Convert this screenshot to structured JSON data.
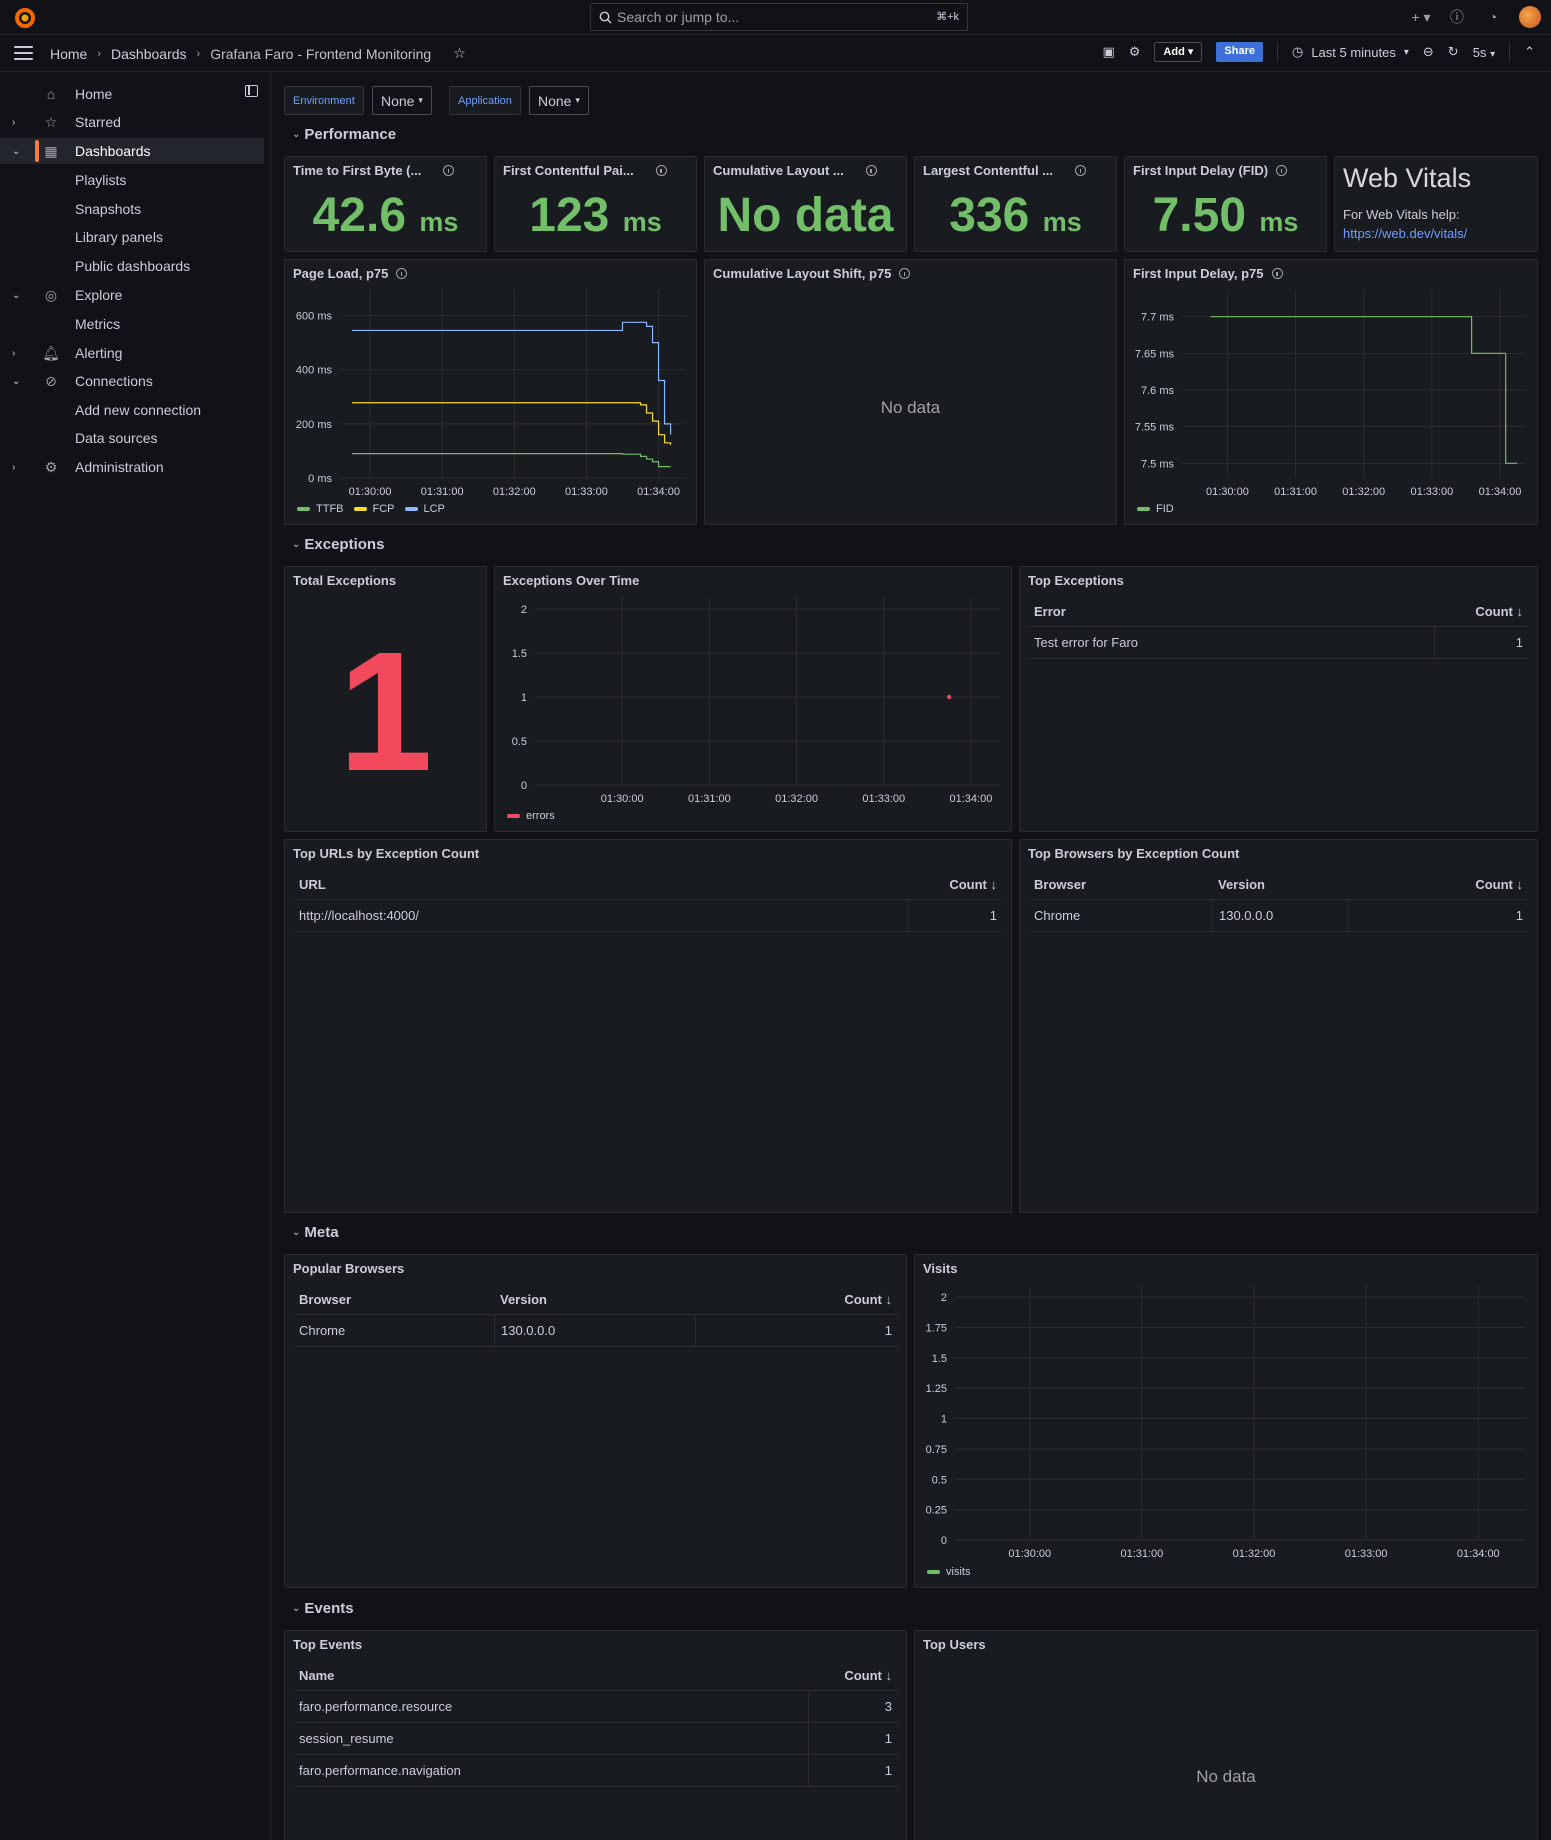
{
  "topbar": {
    "search_placeholder": "Search or jump to...",
    "search_shortcut": "⌘+k"
  },
  "nav": {
    "breadcrumbs": [
      "Home",
      "Dashboards",
      "Grafana Faro - Frontend Monitoring"
    ],
    "add_label": "Add",
    "share_label": "Share",
    "time_range": "Last 5 minutes",
    "refresh_interval": "5s"
  },
  "sidebar": {
    "items": [
      {
        "label": "Home",
        "icon": "home-icon"
      },
      {
        "label": "Starred",
        "icon": "star-icon"
      },
      {
        "label": "Dashboards",
        "icon": "apps-icon"
      },
      {
        "label": "Playlists"
      },
      {
        "label": "Snapshots"
      },
      {
        "label": "Library panels"
      },
      {
        "label": "Public dashboards"
      },
      {
        "label": "Explore",
        "icon": "compass-icon"
      },
      {
        "label": "Metrics"
      },
      {
        "label": "Alerting",
        "icon": "bell-icon"
      },
      {
        "label": "Connections",
        "icon": "link-icon"
      },
      {
        "label": "Add new connection"
      },
      {
        "label": "Data sources"
      },
      {
        "label": "Administration",
        "icon": "cog-icon"
      }
    ]
  },
  "variables": {
    "environment_label": "Environment",
    "environment_value": "None",
    "application_label": "Application",
    "application_value": "None"
  },
  "rows": {
    "performance": "Performance",
    "exceptions": "Exceptions",
    "meta": "Meta",
    "events": "Events"
  },
  "stats": {
    "ttfb": {
      "title": "Time to First Byte (...",
      "value": "42.6",
      "unit": "ms"
    },
    "fcp": {
      "title": "First Contentful Pai...",
      "value": "123",
      "unit": "ms"
    },
    "cls": {
      "title": "Cumulative Layout ...",
      "value": "No data",
      "unit": ""
    },
    "lcp": {
      "title": "Largest Contentful ...",
      "value": "336",
      "unit": "ms"
    },
    "fid": {
      "title": "First Input Delay (FID)",
      "value": "7.50",
      "unit": "ms"
    }
  },
  "web_vitals": {
    "title": "Web Vitals",
    "help": "For Web Vitals help:",
    "link": "https://web.dev/vitals/"
  },
  "panels": {
    "page_load": "Page Load, p75",
    "cls_p75": "Cumulative Layout Shift, p75",
    "cls_nodata": "No data",
    "fid_p75": "First Input Delay, p75",
    "total_exceptions": "Total Exceptions",
    "total_exceptions_value": "1",
    "exceptions_over_time": "Exceptions Over Time",
    "top_exceptions": "Top Exceptions",
    "top_urls": "Top URLs by Exception Count",
    "top_browsers": "Top Browsers by Exception Count",
    "popular_browsers": "Popular Browsers",
    "visits": "Visits",
    "top_events": "Top Events",
    "top_users": "Top Users",
    "top_users_nodata": "No data"
  },
  "tables": {
    "top_exceptions": {
      "headers": [
        "Error",
        "Count"
      ],
      "rows": [
        [
          "Test error for Faro",
          "1"
        ]
      ]
    },
    "top_urls": {
      "headers": [
        "URL",
        "Count"
      ],
      "rows": [
        [
          "http://localhost:4000/",
          "1"
        ]
      ]
    },
    "top_browsers": {
      "headers": [
        "Browser",
        "Version",
        "Count"
      ],
      "rows": [
        [
          "Chrome",
          "130.0.0.0",
          "1"
        ]
      ]
    },
    "popular_browsers": {
      "headers": [
        "Browser",
        "Version",
        "Count"
      ],
      "rows": [
        [
          "Chrome",
          "130.0.0.0",
          "1"
        ]
      ]
    },
    "top_events": {
      "headers": [
        "Name",
        "Count"
      ],
      "rows": [
        [
          "faro.performance.resource",
          "3"
        ],
        [
          "session_resume",
          "1"
        ],
        [
          "faro.performance.navigation",
          "1"
        ]
      ]
    }
  },
  "colors": {
    "green": "#73bf69",
    "yellow": "#fade2a",
    "blue": "#8ab8ff",
    "red": "#f2495c",
    "accent": "#ff7a3d"
  },
  "chart_data": [
    {
      "type": "line",
      "title": "Page Load, p75",
      "x": [
        "01:29:45",
        "01:30:00",
        "01:31:00",
        "01:32:00",
        "01:33:00",
        "01:33:30",
        "01:33:45",
        "01:33:50",
        "01:33:55",
        "01:34:00",
        "01:34:05",
        "01:34:10"
      ],
      "x_ticks": [
        "01:30:00",
        "01:31:00",
        "01:32:00",
        "01:33:00",
        "01:34:00"
      ],
      "y_ticks": [
        "0 ms",
        "200 ms",
        "400 ms",
        "600 ms"
      ],
      "ylim": [
        0,
        650
      ],
      "series": [
        {
          "name": "TTFB",
          "values": [
            90,
            90,
            90,
            90,
            90,
            88,
            80,
            70,
            60,
            42,
            42,
            42
          ]
        },
        {
          "name": "FCP",
          "values": [
            278,
            278,
            278,
            278,
            278,
            278,
            270,
            240,
            210,
            160,
            130,
            123
          ]
        },
        {
          "name": "LCP",
          "values": [
            545,
            545,
            545,
            545,
            545,
            575,
            575,
            560,
            500,
            360,
            200,
            160
          ]
        }
      ]
    },
    {
      "type": "line",
      "title": "First Input Delay, p75",
      "x": [
        "01:29:45",
        "01:30:00",
        "01:31:00",
        "01:32:00",
        "01:33:00",
        "01:33:30",
        "01:33:35",
        "01:34:00",
        "01:34:05",
        "01:34:15"
      ],
      "x_ticks": [
        "01:30:00",
        "01:31:00",
        "01:32:00",
        "01:33:00",
        "01:34:00"
      ],
      "y_ticks": [
        "7.5 ms",
        "7.55 ms",
        "7.6 ms",
        "7.65 ms",
        "7.7 ms"
      ],
      "ylim": [
        7.48,
        7.72
      ],
      "series": [
        {
          "name": "FID",
          "values": [
            7.7,
            7.7,
            7.7,
            7.7,
            7.7,
            7.7,
            7.65,
            7.65,
            7.5,
            7.5
          ]
        }
      ]
    },
    {
      "type": "scatter",
      "title": "Exceptions Over Time",
      "x": [
        "01:33:45"
      ],
      "x_ticks": [
        "01:30:00",
        "01:31:00",
        "01:32:00",
        "01:33:00",
        "01:34:00"
      ],
      "y_ticks": [
        "0",
        "0.5",
        "1",
        "1.5",
        "2"
      ],
      "ylim": [
        0,
        2
      ],
      "series": [
        {
          "name": "errors",
          "values": [
            1
          ]
        }
      ]
    },
    {
      "type": "line",
      "title": "Visits",
      "x": [],
      "x_ticks": [
        "01:30:00",
        "01:31:00",
        "01:32:00",
        "01:33:00",
        "01:34:00"
      ],
      "y_ticks": [
        "0",
        "0.25",
        "0.5",
        "0.75",
        "1",
        "1.25",
        "1.5",
        "1.75",
        "2"
      ],
      "ylim": [
        0,
        2
      ],
      "series": [
        {
          "name": "visits",
          "values": []
        }
      ]
    }
  ]
}
